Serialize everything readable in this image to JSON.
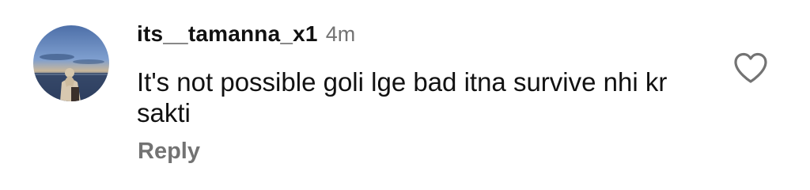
{
  "comment": {
    "username": "its__tamanna_x1",
    "time": "4m",
    "text": "It's not possible goli lge bad itna survive nhi kr sakti",
    "reply_label": "Reply",
    "like_icon": "heart-outline",
    "avatar_icon": "profile-photo"
  },
  "colors": {
    "text": "#111111",
    "muted": "#737373",
    "background": "#ffffff"
  }
}
